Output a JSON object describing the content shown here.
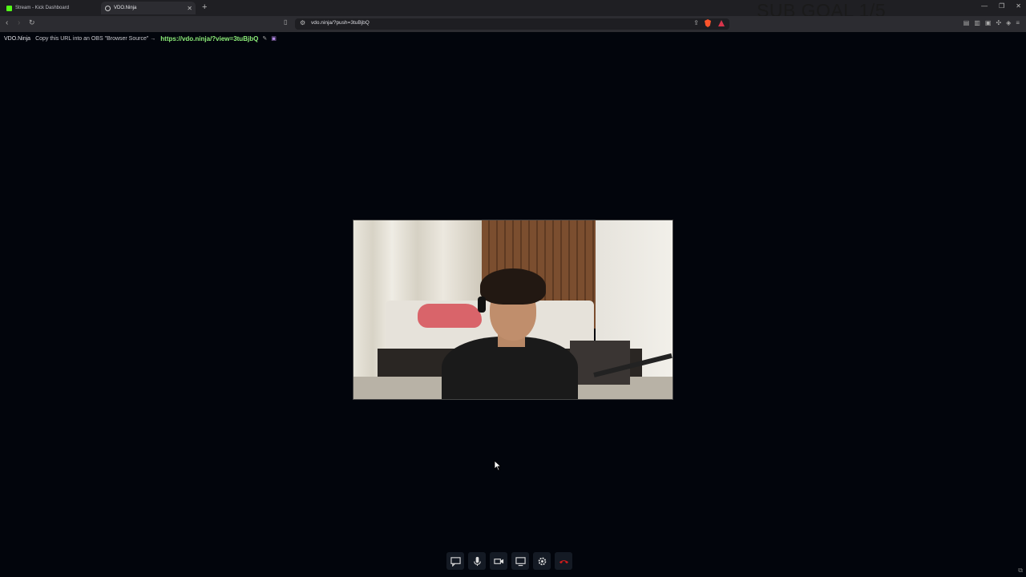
{
  "tabs": [
    {
      "title": "Stream - Kick Dashboard",
      "icon": "kick-favicon"
    },
    {
      "title": "VDO.Ninja",
      "icon": "vdo-ninja-favicon",
      "active": true
    }
  ],
  "overlay": {
    "sub_goal": "SUB GOAL 1/5"
  },
  "address_bar": {
    "url": "vdo.ninja/?push=3tuBjbQ"
  },
  "info_bar": {
    "brand": "VDO.Ninja",
    "hint": "Copy this URL into an OBS \"Browser Source\" →",
    "link": "https://vdo.ninja/?view=3tuBjbQ"
  },
  "toolbar": {
    "buttons": [
      "chat-icon",
      "microphone-icon",
      "camera-icon",
      "screen-share-icon",
      "settings-icon",
      "hang-up-icon"
    ]
  },
  "colors": {
    "background": "#02050c",
    "link": "#8ef07a",
    "hangup": "#d11b1b",
    "brave": "#fb542b"
  }
}
